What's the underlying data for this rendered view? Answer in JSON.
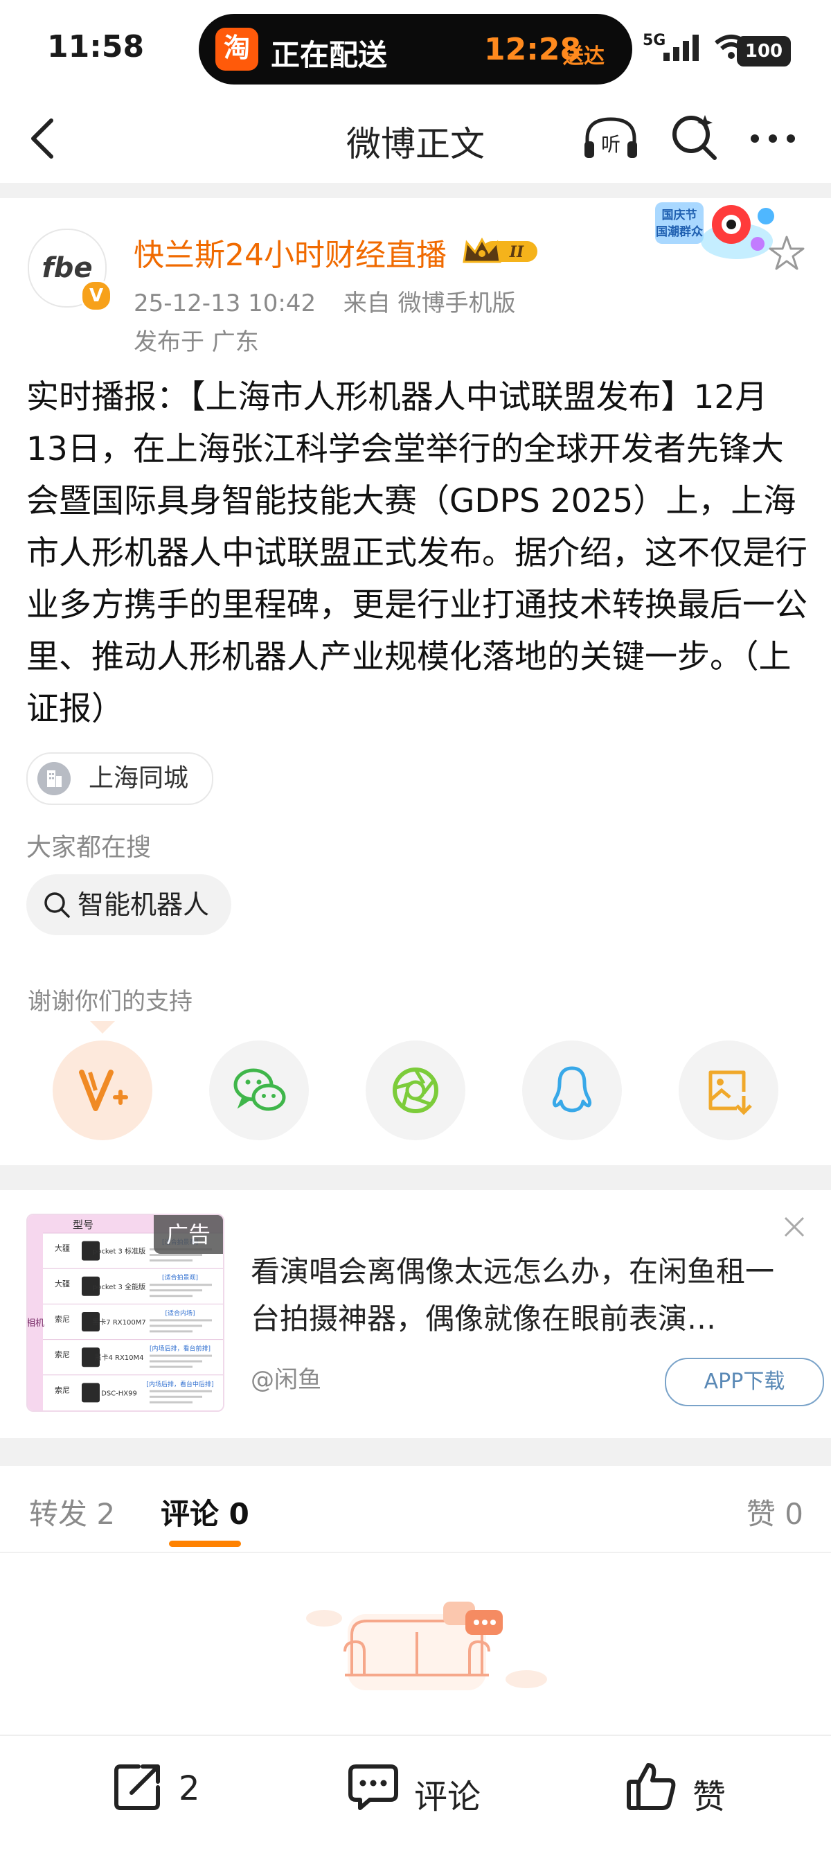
{
  "status_bar": {
    "time": "11:58",
    "pill_logo": "淘",
    "pill_text": "正在配送",
    "pill_time": "12:28",
    "pill_deliver": "送达",
    "network": "5G",
    "battery": "100"
  },
  "nav": {
    "title": "微博正文",
    "listen_label": "听"
  },
  "post": {
    "author": "快兰斯24小时财经直播",
    "avatar_text": "fbe",
    "verified_badge": "V",
    "crown_level": "II",
    "timestamp": "25-12-13 10:42",
    "source": "来自 微博手机版",
    "location": "发布于 广东",
    "body": "实时播报：【上海市人形机器人中试联盟发布】12月13日，在上海张江科学会堂举行的全球开发者先锋大会暨国际具身智能技能大赛（GDPS 2025）上，上海市人形机器人中试联盟正式发布。据介绍，这不仅是行业多方携手的里程碑，更是行业打通技术转换最后一公里、推动人形机器人产业规模化落地的关键一步。（上证报）",
    "tag": "上海同城",
    "search_label": "大家都在搜",
    "search_chip": "智能机器人",
    "thanks": "谢谢你们的支持",
    "sticker_text": "国庆节\n国潮群众"
  },
  "share_icons": [
    "vplus-icon",
    "wechat-icon",
    "moments-icon",
    "qq-icon",
    "save-image-icon"
  ],
  "ad": {
    "badge": "广告",
    "text": "看演唱会离偶像太远怎么办，在闲鱼租一台拍摄神器，偶像就像在眼前表演…",
    "source": "@闲鱼",
    "button": "APP下载",
    "thumb": {
      "header": "型号",
      "side_label": "相机",
      "rows": [
        {
          "brand": "大疆",
          "model": "pocket 3 标准版",
          "tag": "[适合拍景观]"
        },
        {
          "brand": "大疆",
          "model": "pocket 3 全能版",
          "tag": "[适合拍景观]"
        },
        {
          "brand": "索尼",
          "model": "黑卡7 RX100M7",
          "tag": "[适合内场]"
        },
        {
          "brand": "索尼",
          "model": "黑卡4 RX10M4",
          "tag": "[内场后排，看台前排]"
        },
        {
          "brand": "索尼",
          "model": "DSC-HX99",
          "tag": "[内场后排，看台中后排]"
        }
      ]
    }
  },
  "tabs": {
    "repost": "转发 2",
    "comments": "评论 0",
    "likes": "赞 0"
  },
  "bottom_bar": {
    "repost_count": "2",
    "comment_label": "评论",
    "like_label": "赞"
  },
  "colors": {
    "brand_orange": "#f06a00",
    "tab_underline": "#ff8200",
    "meta_gray": "#8a8a8a"
  }
}
